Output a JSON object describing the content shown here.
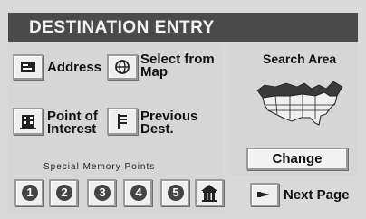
{
  "header": {
    "title": "DESTINATION ENTRY"
  },
  "entry_buttons": {
    "address": "Address",
    "map_line1": "Select from",
    "map_line2": "Map",
    "poi_line1": "Point of",
    "poi_line2": "Interest",
    "prev_line1": "Previous",
    "prev_line2": "Dest."
  },
  "memory": {
    "label": "Special Memory Points",
    "points": [
      "1",
      "2",
      "3",
      "4",
      "5"
    ],
    "home_icon": "home-icon"
  },
  "search_area": {
    "title": "Search Area",
    "change_label": "Change",
    "map_icon": "usa-map-icon"
  },
  "navigation": {
    "next_page_label": "Next Page"
  },
  "colors": {
    "title_bar": "#4a4a4a",
    "background": "#d9d9d9",
    "button": "#efefef"
  }
}
